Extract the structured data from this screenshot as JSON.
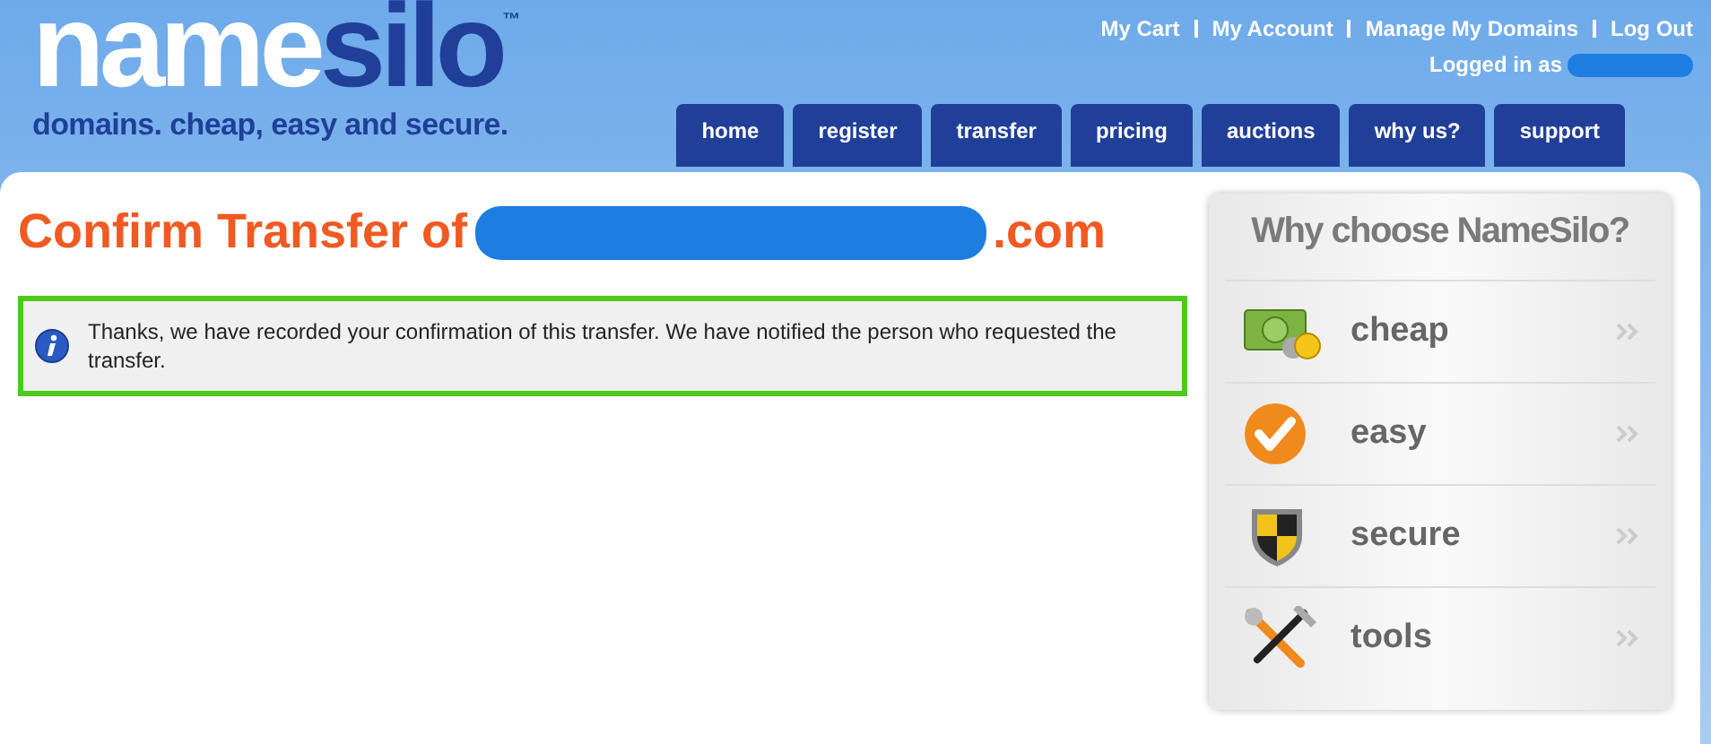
{
  "logo": {
    "light": "name",
    "dark": "silo",
    "trademark": "™",
    "tagline": "domains. cheap, easy and secure."
  },
  "top_links": [
    "My Cart",
    "My Account",
    "Manage My Domains",
    "Log Out"
  ],
  "logged_in_label": "Logged in as",
  "nav": [
    {
      "label": "home",
      "selected": false
    },
    {
      "label": "register",
      "selected": false
    },
    {
      "label": "transfer",
      "selected": false
    },
    {
      "label": "pricing",
      "selected": false
    },
    {
      "label": "auctions",
      "selected": false
    },
    {
      "label": "why us?",
      "selected": false
    },
    {
      "label": "support",
      "selected": false
    }
  ],
  "heading": {
    "prefix": "Confirm Transfer of",
    "suffix": ".com"
  },
  "notice": "Thanks, we have recorded your confirmation of this transfer. We have notified the person who requested the transfer.",
  "why": {
    "title": "Why choose NameSilo?",
    "items": [
      {
        "label": "cheap",
        "kind": "money"
      },
      {
        "label": "easy",
        "kind": "check"
      },
      {
        "label": "secure",
        "kind": "shield"
      },
      {
        "label": "tools",
        "kind": "tools"
      }
    ]
  }
}
